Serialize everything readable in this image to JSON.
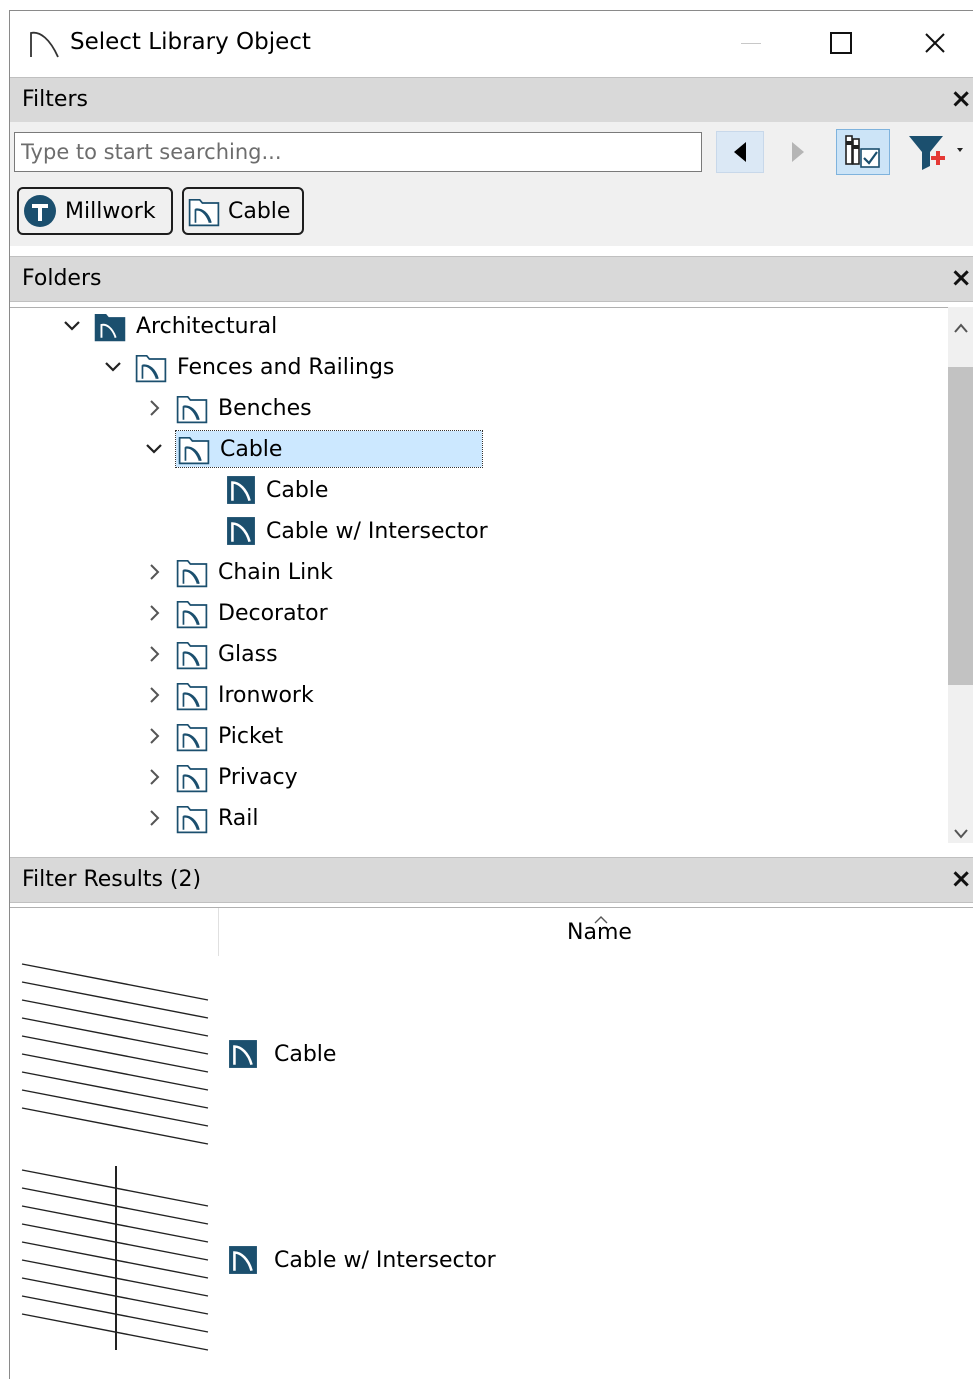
{
  "window": {
    "title": "Select Library Object",
    "minimize_label": "—",
    "maximize_label": "☐",
    "close_label": "✕"
  },
  "filters": {
    "header": "Filters",
    "close_label": "×",
    "search_placeholder": "Type to start searching...",
    "chips": [
      {
        "label": "Millwork",
        "icon": "millwork-t-icon"
      },
      {
        "label": "Cable",
        "icon": "library-folder-icon"
      }
    ]
  },
  "folders": {
    "header": "Folders",
    "close_label": "×",
    "items": [
      {
        "label": "Architectural",
        "level": 0,
        "state": "expanded",
        "icon": "library-folder-solid-icon"
      },
      {
        "label": "Fences and Railings",
        "level": 1,
        "state": "expanded",
        "icon": "library-folder-icon"
      },
      {
        "label": "Benches",
        "level": 2,
        "state": "collapsed",
        "icon": "library-folder-icon"
      },
      {
        "label": "Cable",
        "level": 2,
        "state": "expanded",
        "icon": "library-folder-icon",
        "selected": true
      },
      {
        "label": "Cable",
        "level": 3,
        "state": "leaf",
        "icon": "library-item-icon"
      },
      {
        "label": "Cable w/ Intersector",
        "level": 3,
        "state": "leaf",
        "icon": "library-item-icon"
      },
      {
        "label": "Chain Link",
        "level": 2,
        "state": "collapsed",
        "icon": "library-folder-icon"
      },
      {
        "label": "Decorator",
        "level": 2,
        "state": "collapsed",
        "icon": "library-folder-icon"
      },
      {
        "label": "Glass",
        "level": 2,
        "state": "collapsed",
        "icon": "library-folder-icon"
      },
      {
        "label": "Ironwork",
        "level": 2,
        "state": "collapsed",
        "icon": "library-folder-icon"
      },
      {
        "label": "Picket",
        "level": 2,
        "state": "collapsed",
        "icon": "library-folder-icon"
      },
      {
        "label": "Privacy",
        "level": 2,
        "state": "collapsed",
        "icon": "library-folder-icon"
      },
      {
        "label": "Rail",
        "level": 2,
        "state": "collapsed",
        "icon": "library-folder-icon"
      }
    ]
  },
  "results": {
    "header": "Filter Results (2)",
    "close_label": "×",
    "column_name": "Name",
    "items": [
      {
        "label": "Cable",
        "preview": "cable-preview"
      },
      {
        "label": "Cable w/ Intersector",
        "preview": "cable-intersector-preview"
      }
    ]
  },
  "colors": {
    "accent_item": "#1b4f6e",
    "selection": "#cce8ff",
    "pane_header": "#d9d9d9",
    "nav_back_bg": "#dbe8f5"
  }
}
